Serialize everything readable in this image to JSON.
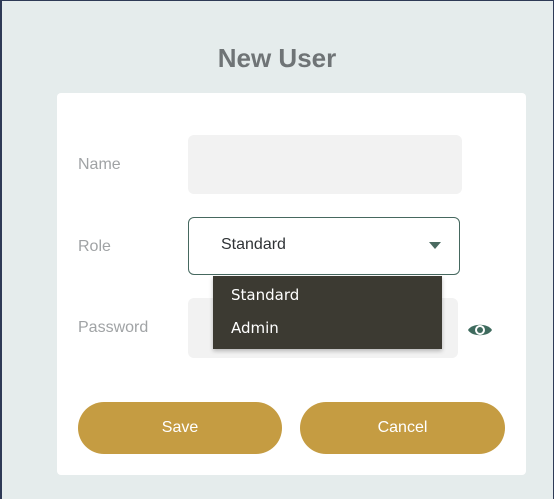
{
  "dialog": {
    "title": "New User"
  },
  "form": {
    "name_label": "Name",
    "name_value": "",
    "role_label": "Role",
    "role_selected": "Standard",
    "password_label": "Password",
    "password_value": ""
  },
  "role_dropdown": {
    "options": [
      "Standard",
      "Admin"
    ]
  },
  "buttons": {
    "save_label": "Save",
    "cancel_label": "Cancel"
  },
  "icons": {
    "caret": "chevron-down-icon",
    "password_toggle": "eye-icon"
  },
  "colors": {
    "background": "#e5ecec",
    "button": "#c59c42",
    "select_border": "#46685f",
    "dropdown_bg": "#3c3a32",
    "eye_icon": "#3f6b5e"
  }
}
